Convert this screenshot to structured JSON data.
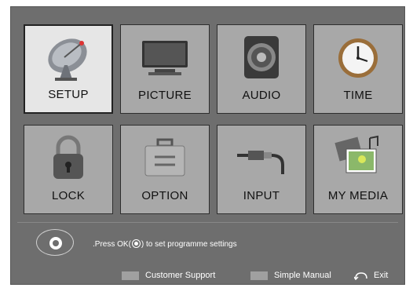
{
  "menu": {
    "tiles": [
      {
        "label": "SETUP",
        "icon": "satellite-dish-icon",
        "selected": true
      },
      {
        "label": "PICTURE",
        "icon": "monitor-icon"
      },
      {
        "label": "AUDIO",
        "icon": "speaker-icon"
      },
      {
        "label": "TIME",
        "icon": "clock-icon"
      },
      {
        "label": "LOCK",
        "icon": "padlock-icon"
      },
      {
        "label": "OPTION",
        "icon": "toolbox-icon"
      },
      {
        "label": "INPUT",
        "icon": "cable-plug-icon"
      },
      {
        "label": "MY MEDIA",
        "icon": "media-photos-icon"
      }
    ]
  },
  "hint": {
    "prefix": ".Press OK(",
    "suffix": ") to set programme settings"
  },
  "footer": {
    "customer_support": "Customer Support",
    "simple_manual": "Simple Manual",
    "exit": "Exit"
  },
  "colors": {
    "background": "#6e6e6e",
    "tile": "#a8a8a8",
    "tile_selected": "#e6e6e6",
    "swatch": "#a0a0a0"
  }
}
